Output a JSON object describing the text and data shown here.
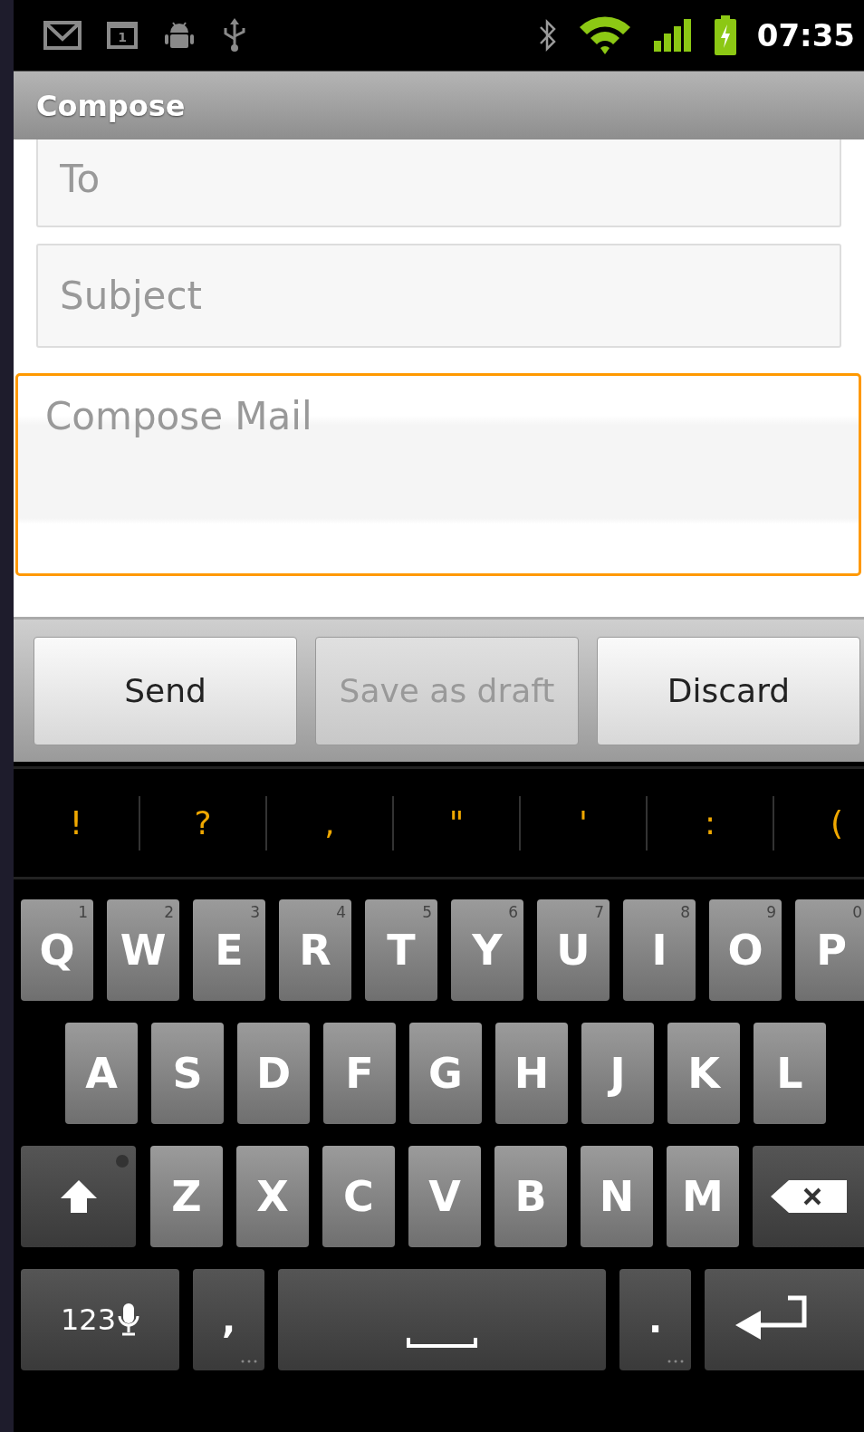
{
  "status_bar": {
    "calendar_day": "1",
    "time": "07:35"
  },
  "title_bar": {
    "title": "Compose"
  },
  "fields": [
    {
      "kind": "line",
      "placeholder": "To",
      "focused": false
    },
    {
      "kind": "line",
      "placeholder": "Subject",
      "focused": false
    },
    {
      "kind": "body",
      "placeholder": "Compose Mail",
      "focused": true
    }
  ],
  "buttons": [
    {
      "label": "Send",
      "disabled": false
    },
    {
      "label": "Save as draft",
      "disabled": true
    },
    {
      "label": "Discard",
      "disabled": false
    }
  ],
  "suggestions": [
    "!",
    "?",
    ",",
    "\"",
    "'",
    ":",
    "("
  ],
  "keyboard": {
    "rows": [
      [
        {
          "kind": "letter",
          "label": "Q",
          "hint": "1"
        },
        {
          "kind": "letter",
          "label": "W",
          "hint": "2"
        },
        {
          "kind": "letter",
          "label": "E",
          "hint": "3"
        },
        {
          "kind": "letter",
          "label": "R",
          "hint": "4"
        },
        {
          "kind": "letter",
          "label": "T",
          "hint": "5"
        },
        {
          "kind": "letter",
          "label": "Y",
          "hint": "6"
        },
        {
          "kind": "letter",
          "label": "U",
          "hint": "7"
        },
        {
          "kind": "letter",
          "label": "I",
          "hint": "8"
        },
        {
          "kind": "letter",
          "label": "O",
          "hint": "9"
        },
        {
          "kind": "letter",
          "label": "P",
          "hint": "0"
        }
      ],
      [
        {
          "kind": "letter",
          "label": "A"
        },
        {
          "kind": "letter",
          "label": "S"
        },
        {
          "kind": "letter",
          "label": "D"
        },
        {
          "kind": "letter",
          "label": "F"
        },
        {
          "kind": "letter",
          "label": "G"
        },
        {
          "kind": "letter",
          "label": "H"
        },
        {
          "kind": "letter",
          "label": "J"
        },
        {
          "kind": "letter",
          "label": "K"
        },
        {
          "kind": "letter",
          "label": "L"
        }
      ],
      [
        {
          "kind": "shift"
        },
        {
          "kind": "letter",
          "label": "Z"
        },
        {
          "kind": "letter",
          "label": "X"
        },
        {
          "kind": "letter",
          "label": "C"
        },
        {
          "kind": "letter",
          "label": "V"
        },
        {
          "kind": "letter",
          "label": "B"
        },
        {
          "kind": "letter",
          "label": "N"
        },
        {
          "kind": "letter",
          "label": "M"
        },
        {
          "kind": "backspace"
        }
      ],
      [
        {
          "kind": "mode",
          "label": "123"
        },
        {
          "kind": "punct",
          "label": ","
        },
        {
          "kind": "space"
        },
        {
          "kind": "punct",
          "label": "."
        },
        {
          "kind": "enter"
        }
      ]
    ]
  }
}
